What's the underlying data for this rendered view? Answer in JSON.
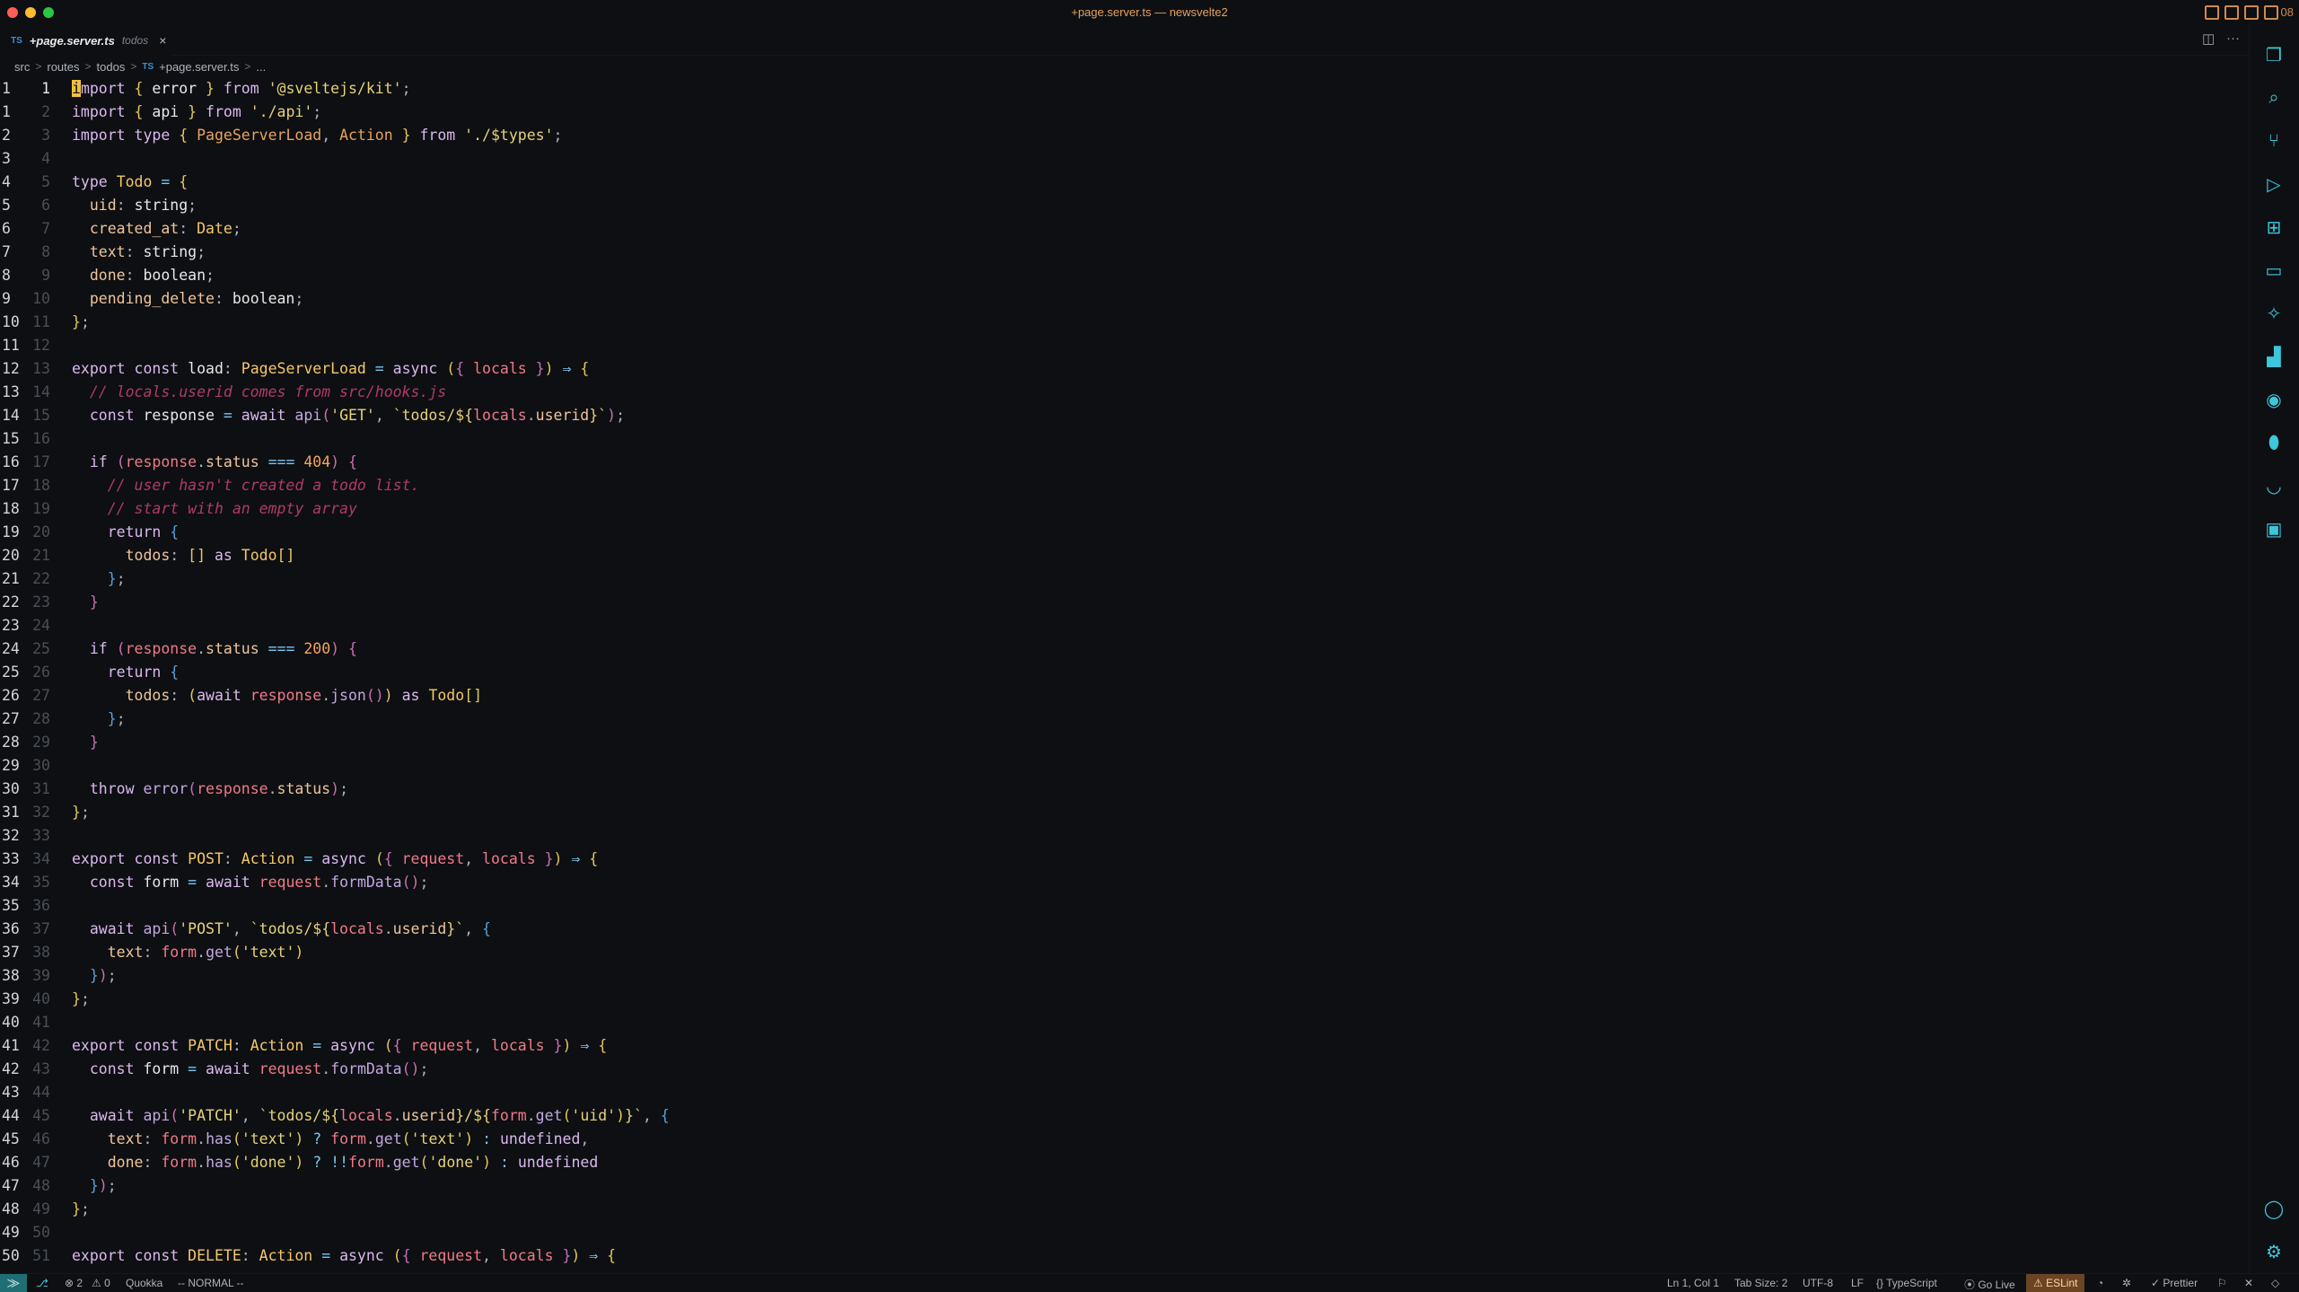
{
  "window": {
    "title": "+page.server.ts — newsvelte2",
    "extra": "08"
  },
  "tab": {
    "badge": "TS",
    "name": "+page.server.ts",
    "dir": "todos",
    "close": "×"
  },
  "tab_actions": {
    "split": "◫",
    "more": "···"
  },
  "breadcrumb": {
    "parts": [
      "src",
      "routes",
      "todos"
    ],
    "badge": "TS",
    "file": "+page.server.ts",
    "symbol": "..."
  },
  "editor": {
    "lines": [
      {
        "rel": "1",
        "abs": "1",
        "html": "<span class='cursor'>i</span><span class='kw'>mport</span> <span class='br1'>{</span> <span class='var'>error</span> <span class='br1'>}</span> <span class='kw'>from</span> <span class='str'>'@sveltejs/kit'</span><span class='pun'>;</span>"
      },
      {
        "rel": "1",
        "abs": "2",
        "html": "<span class='kw'>import</span> <span class='br1'>{</span> <span class='var'>api</span> <span class='br1'>}</span> <span class='kw'>from</span> <span class='str'>'./api'</span><span class='pun'>;</span>"
      },
      {
        "rel": "2",
        "abs": "3",
        "html": "<span class='kw'>import</span> <span class='kw'>type</span> <span class='br1'>{</span> <span class='tyo'>PageServerLoad</span><span class='pun'>,</span> <span class='tyo'>Action</span> <span class='br1'>}</span> <span class='kw'>from</span> <span class='str'>'./$types'</span><span class='pun'>;</span>"
      },
      {
        "rel": "3",
        "abs": "4",
        "html": ""
      },
      {
        "rel": "4",
        "abs": "5",
        "html": "<span class='kw'>type</span> <span class='ty'>Todo</span> <span class='op'>=</span> <span class='br1'>{</span>"
      },
      {
        "rel": "5",
        "abs": "6",
        "html": "  <span class='prop'>uid</span><span class='pun'>:</span> <span class='var'>string</span><span class='pun'>;</span>"
      },
      {
        "rel": "6",
        "abs": "7",
        "html": "  <span class='prop'>created_at</span><span class='pun'>:</span> <span class='ty'>Date</span><span class='pun'>;</span>"
      },
      {
        "rel": "7",
        "abs": "8",
        "html": "  <span class='prop'>text</span><span class='pun'>:</span> <span class='var'>string</span><span class='pun'>;</span>"
      },
      {
        "rel": "8",
        "abs": "9",
        "html": "  <span class='prop'>done</span><span class='pun'>:</span> <span class='var'>boolean</span><span class='pun'>;</span>"
      },
      {
        "rel": "9",
        "abs": "10",
        "html": "  <span class='prop'>pending_delete</span><span class='pun'>:</span> <span class='var'>boolean</span><span class='pun'>;</span>"
      },
      {
        "rel": "10",
        "abs": "11",
        "html": "<span class='br1'>}</span><span class='pun'>;</span>"
      },
      {
        "rel": "11",
        "abs": "12",
        "html": ""
      },
      {
        "rel": "12",
        "abs": "13",
        "html": "<span class='kw'>export</span> <span class='kw'>const</span> <span class='var'>load</span><span class='pun'>:</span> <span class='ty'>PageServerLoad</span> <span class='op'>=</span> <span class='kw'>async</span> <span class='br1'>(</span><span class='br2'>{</span> <span class='param'>locals</span> <span class='br2'>}</span><span class='br1'>)</span> <span class='op'>⇒</span> <span class='br1'>{</span>"
      },
      {
        "rel": "13",
        "abs": "14",
        "html": "  <span class='com'>// locals.userid comes from src/hooks.js</span>"
      },
      {
        "rel": "14",
        "abs": "15",
        "html": "  <span class='kw'>const</span> <span class='var'>response</span> <span class='op'>=</span> <span class='kw'>await</span> <span class='fn'>api</span><span class='br2'>(</span><span class='str'>'GET'</span><span class='pun'>,</span> <span class='tpl'>`todos/${</span><span class='param'>locals</span><span class='pun'>.</span><span class='prop'>userid</span><span class='tpl'>}`</span><span class='br2'>)</span><span class='pun'>;</span>"
      },
      {
        "rel": "15",
        "abs": "16",
        "html": ""
      },
      {
        "rel": "16",
        "abs": "17",
        "html": "  <span class='kw'>if</span> <span class='br2'>(</span><span class='param'>response</span><span class='pun'>.</span><span class='prop'>status</span> <span class='op'>===</span> <span class='num'>404</span><span class='br2'>)</span> <span class='br2'>{</span>"
      },
      {
        "rel": "17",
        "abs": "18",
        "html": "    <span class='com'>// user hasn't created a todo list.</span>"
      },
      {
        "rel": "18",
        "abs": "19",
        "html": "    <span class='com'>// start with an empty array</span>"
      },
      {
        "rel": "19",
        "abs": "20",
        "html": "    <span class='kw'>return</span> <span class='br3'>{</span>"
      },
      {
        "rel": "20",
        "abs": "21",
        "html": "      <span class='prop'>todos</span><span class='pun'>:</span> <span class='br1'>[]</span> <span class='kw'>as</span> <span class='ty'>Todo</span><span class='br1'>[]</span>"
      },
      {
        "rel": "21",
        "abs": "22",
        "html": "    <span class='br3'>}</span><span class='pun'>;</span>"
      },
      {
        "rel": "22",
        "abs": "23",
        "html": "  <span class='br2'>}</span>"
      },
      {
        "rel": "23",
        "abs": "24",
        "html": ""
      },
      {
        "rel": "24",
        "abs": "25",
        "html": "  <span class='kw'>if</span> <span class='br2'>(</span><span class='param'>response</span><span class='pun'>.</span><span class='prop'>status</span> <span class='op'>===</span> <span class='num'>200</span><span class='br2'>)</span> <span class='br2'>{</span>"
      },
      {
        "rel": "25",
        "abs": "26",
        "html": "    <span class='kw'>return</span> <span class='br3'>{</span>"
      },
      {
        "rel": "26",
        "abs": "27",
        "html": "      <span class='prop'>todos</span><span class='pun'>:</span> <span class='br1'>(</span><span class='kw'>await</span> <span class='param'>response</span><span class='pun'>.</span><span class='fn'>json</span><span class='br2'>()</span><span class='br1'>)</span> <span class='kw'>as</span> <span class='ty'>Todo</span><span class='br1'>[]</span>"
      },
      {
        "rel": "27",
        "abs": "28",
        "html": "    <span class='br3'>}</span><span class='pun'>;</span>"
      },
      {
        "rel": "28",
        "abs": "29",
        "html": "  <span class='br2'>}</span>"
      },
      {
        "rel": "29",
        "abs": "30",
        "html": ""
      },
      {
        "rel": "30",
        "abs": "31",
        "html": "  <span class='kw'>throw</span> <span class='fn'>error</span><span class='br2'>(</span><span class='param'>response</span><span class='pun'>.</span><span class='prop'>status</span><span class='br2'>)</span><span class='pun'>;</span>"
      },
      {
        "rel": "31",
        "abs": "32",
        "html": "<span class='br1'>}</span><span class='pun'>;</span>"
      },
      {
        "rel": "32",
        "abs": "33",
        "html": ""
      },
      {
        "rel": "33",
        "abs": "34",
        "html": "<span class='kw'>export</span> <span class='kw'>const</span> <span class='ty'>POST</span><span class='pun'>:</span> <span class='ty'>Action</span> <span class='op'>=</span> <span class='kw'>async</span> <span class='br1'>(</span><span class='br2'>{</span> <span class='param'>request</span><span class='pun'>,</span> <span class='param'>locals</span> <span class='br2'>}</span><span class='br1'>)</span> <span class='op'>⇒</span> <span class='br1'>{</span>"
      },
      {
        "rel": "34",
        "abs": "35",
        "html": "  <span class='kw'>const</span> <span class='var'>form</span> <span class='op'>=</span> <span class='kw'>await</span> <span class='param'>request</span><span class='pun'>.</span><span class='fn'>formData</span><span class='br2'>()</span><span class='pun'>;</span>"
      },
      {
        "rel": "35",
        "abs": "36",
        "html": ""
      },
      {
        "rel": "36",
        "abs": "37",
        "html": "  <span class='kw'>await</span> <span class='fn'>api</span><span class='br2'>(</span><span class='str'>'POST'</span><span class='pun'>,</span> <span class='tpl'>`todos/${</span><span class='param'>locals</span><span class='pun'>.</span><span class='prop'>userid</span><span class='tpl'>}`</span><span class='pun'>,</span> <span class='br3'>{</span>"
      },
      {
        "rel": "37",
        "abs": "38",
        "html": "    <span class='prop'>text</span><span class='pun'>:</span> <span class='param'>form</span><span class='pun'>.</span><span class='fn'>get</span><span class='br1'>(</span><span class='str'>'text'</span><span class='br1'>)</span>"
      },
      {
        "rel": "38",
        "abs": "39",
        "html": "  <span class='br3'>}</span><span class='br2'>)</span><span class='pun'>;</span>"
      },
      {
        "rel": "39",
        "abs": "40",
        "html": "<span class='br1'>}</span><span class='pun'>;</span>"
      },
      {
        "rel": "40",
        "abs": "41",
        "html": ""
      },
      {
        "rel": "41",
        "abs": "42",
        "html": "<span class='kw'>export</span> <span class='kw'>const</span> <span class='ty'>PATCH</span><span class='pun'>:</span> <span class='ty'>Action</span> <span class='op'>=</span> <span class='kw'>async</span> <span class='br1'>(</span><span class='br2'>{</span> <span class='param'>request</span><span class='pun'>,</span> <span class='param'>locals</span> <span class='br2'>}</span><span class='br1'>)</span> <span class='op'>⇒</span> <span class='br1'>{</span>"
      },
      {
        "rel": "42",
        "abs": "43",
        "html": "  <span class='kw'>const</span> <span class='var'>form</span> <span class='op'>=</span> <span class='kw'>await</span> <span class='param'>request</span><span class='pun'>.</span><span class='fn'>formData</span><span class='br2'>()</span><span class='pun'>;</span>"
      },
      {
        "rel": "43",
        "abs": "44",
        "html": ""
      },
      {
        "rel": "44",
        "abs": "45",
        "html": "  <span class='kw'>await</span> <span class='fn'>api</span><span class='br2'>(</span><span class='str'>'PATCH'</span><span class='pun'>,</span> <span class='tpl'>`todos/${</span><span class='param'>locals</span><span class='pun'>.</span><span class='prop'>userid</span><span class='tpl'>}/${</span><span class='param'>form</span><span class='pun'>.</span><span class='fn'>get</span><span class='br1'>(</span><span class='str'>'uid'</span><span class='br1'>)</span><span class='tpl'>}`</span><span class='pun'>,</span> <span class='br3'>{</span>"
      },
      {
        "rel": "45",
        "abs": "46",
        "html": "    <span class='prop'>text</span><span class='pun'>:</span> <span class='param'>form</span><span class='pun'>.</span><span class='fn'>has</span><span class='br1'>(</span><span class='str'>'text'</span><span class='br1'>)</span> <span class='op'>?</span> <span class='param'>form</span><span class='pun'>.</span><span class='fn'>get</span><span class='br1'>(</span><span class='str'>'text'</span><span class='br1'>)</span> <span class='op'>:</span> <span class='kw'>undefined</span><span class='pun'>,</span>"
      },
      {
        "rel": "46",
        "abs": "47",
        "html": "    <span class='prop'>done</span><span class='pun'>:</span> <span class='param'>form</span><span class='pun'>.</span><span class='fn'>has</span><span class='br1'>(</span><span class='str'>'done'</span><span class='br1'>)</span> <span class='op'>?</span> <span class='op'>!!</span><span class='param'>form</span><span class='pun'>.</span><span class='fn'>get</span><span class='br1'>(</span><span class='str'>'done'</span><span class='br1'>)</span> <span class='op'>:</span> <span class='kw'>undefined</span>"
      },
      {
        "rel": "47",
        "abs": "48",
        "html": "  <span class='br3'>}</span><span class='br2'>)</span><span class='pun'>;</span>"
      },
      {
        "rel": "48",
        "abs": "49",
        "html": "<span class='br1'>}</span><span class='pun'>;</span>"
      },
      {
        "rel": "49",
        "abs": "50",
        "html": ""
      },
      {
        "rel": "50",
        "abs": "51",
        "html": "<span class='kw'>export</span> <span class='kw'>const</span> <span class='ty'>DELETE</span><span class='pun'>:</span> <span class='ty'>Action</span> <span class='op'>=</span> <span class='kw'>async</span> <span class='br1'>(</span><span class='br2'>{</span> <span class='param'>request</span><span class='pun'>,</span> <span class='param'>locals</span> <span class='br2'>}</span><span class='br1'>)</span> <span class='op'>⇒</span> <span class='br1'>{</span>"
      }
    ]
  },
  "activity_bar": [
    {
      "name": "explorer-icon",
      "glyph": "❐"
    },
    {
      "name": "search-icon",
      "glyph": "⌕"
    },
    {
      "name": "source-control-icon",
      "glyph": "⑂"
    },
    {
      "name": "run-debug-icon",
      "glyph": "▷"
    },
    {
      "name": "extensions-icon",
      "glyph": "⊞"
    },
    {
      "name": "remote-explorer-icon",
      "glyph": "▭"
    },
    {
      "name": "live-share-icon",
      "glyph": "✧"
    },
    {
      "name": "docker-icon",
      "glyph": "▟"
    },
    {
      "name": "github-icon",
      "glyph": "◉"
    },
    {
      "name": "mongodb-icon",
      "glyph": "⬮"
    },
    {
      "name": "gitlab-icon",
      "glyph": "◡"
    },
    {
      "name": "terminal-icon",
      "glyph": "▣"
    }
  ],
  "activity_bottom": [
    {
      "name": "account-icon",
      "glyph": "◯"
    },
    {
      "name": "manage-gear-icon",
      "glyph": "⚙"
    }
  ],
  "status": {
    "remote": "⨠",
    "branch_icon": "⎇",
    "errors": "⊗ 2",
    "warnings": "⚠ 0",
    "quokka": "Quokka",
    "vim_mode": "-- NORMAL --",
    "position": "Ln 1, Col 1",
    "tab_size": "Tab Size: 2",
    "encoding": "UTF-8",
    "eol": "LF",
    "language": "{} TypeScript",
    "go_live": "⦿ Go Live",
    "eslint": "⚠ ESLint",
    "prettier": "✓ Prettier"
  }
}
